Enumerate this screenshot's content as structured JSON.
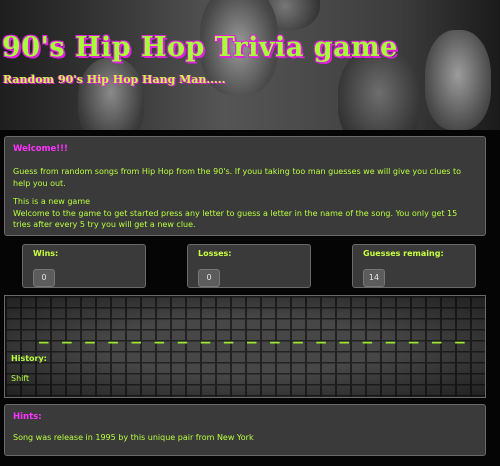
{
  "header": {
    "title": "90's Hip Hop Trivia game",
    "subtitle": "Random 90's Hip Hop Hang Man....."
  },
  "welcome": {
    "heading": "Welcome!!!",
    "intro": "Guess from random songs from Hip Hop from the 90's. If youu taking too man guesses we will give you clues to help you out.",
    "new_game": "This is a new game",
    "instructions": "Welcome to the game to get started press any letter to guess a letter in the name of the song. You only get 15 tries after every 5 try you will get a new clue."
  },
  "stats": {
    "wins_label": "Wins:",
    "wins_value": "0",
    "losses_label": "Losses:",
    "losses_value": "0",
    "guesses_label": "Guesses remaing:",
    "guesses_value": "14"
  },
  "board": {
    "blanks": "_ _ _ _ _ _ _ _ _ _ _ _ _ _ _ _ _ _ _",
    "history_label": "History:",
    "history_value": "Shift"
  },
  "hints": {
    "heading": "Hints:",
    "text": "Song was release in 1995 by this unique pair from New York"
  },
  "colors": {
    "accent_green": "#b8ff40",
    "accent_pink": "#ff33ff",
    "panel_bg": "#3a3a3a",
    "page_bg": "#050505"
  }
}
